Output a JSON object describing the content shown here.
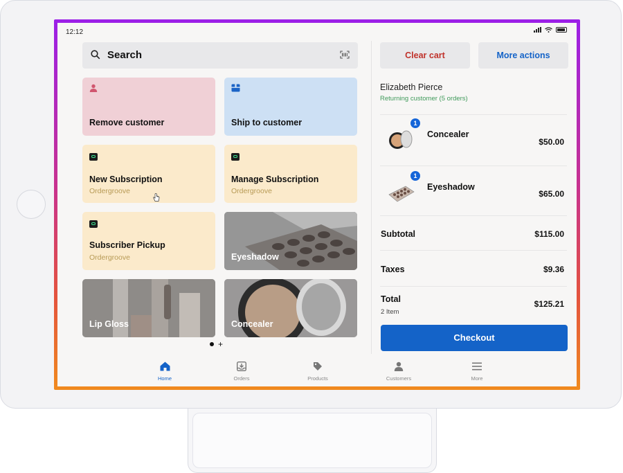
{
  "status_bar": {
    "time": "12:12"
  },
  "search": {
    "label": "Search",
    "icon": "search-icon",
    "scan_icon": "barcode-scan-icon"
  },
  "tiles": {
    "remove_customer": {
      "title": "Remove customer",
      "icon": "person-icon",
      "color": "#f0d0d6"
    },
    "ship_to_customer": {
      "title": "Ship to customer",
      "icon": "ship-box-icon",
      "color": "#cde0f4"
    },
    "new_subscription": {
      "title": "New Subscription",
      "subtitle": "Ordergroove",
      "color": "#fbeacb"
    },
    "manage_subscription": {
      "title": "Manage Subscription",
      "subtitle": "Ordergroove",
      "color": "#fbeacb"
    },
    "subscriber_pickup": {
      "title": "Subscriber Pickup",
      "subtitle": "Ordergroove",
      "color": "#fbeacb"
    },
    "eyeshadow": {
      "title": "Eyeshadow"
    },
    "lip_gloss": {
      "title": "Lip Gloss"
    },
    "concealer": {
      "title": "Concealer"
    }
  },
  "pager": {
    "add": "+"
  },
  "actions": {
    "clear_cart": "Clear cart",
    "more_actions": "More actions"
  },
  "customer": {
    "name": "Elizabeth Pierce",
    "status": "Returning customer (5 orders)"
  },
  "cart": {
    "items": [
      {
        "name": "Concealer",
        "qty": "1",
        "price": "$50.00"
      },
      {
        "name": "Eyeshadow",
        "qty": "1",
        "price": "$65.00"
      }
    ],
    "subtotal_label": "Subtotal",
    "subtotal": "$115.00",
    "taxes_label": "Taxes",
    "taxes": "$9.36",
    "total_label": "Total",
    "total": "$125.21",
    "item_count": "2 Item",
    "checkout": "Checkout"
  },
  "nav": [
    {
      "label": "Home",
      "icon": "home-icon",
      "active": true
    },
    {
      "label": "Orders",
      "icon": "orders-inbox-icon"
    },
    {
      "label": "Products",
      "icon": "tag-icon"
    },
    {
      "label": "Customers",
      "icon": "person-icon"
    },
    {
      "label": "More",
      "icon": "menu-icon"
    }
  ],
  "colors": {
    "accent": "#1463c8",
    "clear_cart": "#c0322b",
    "returning": "#3f9a5a",
    "frame_top": "#9b1fe8",
    "frame_bottom": "#f08a1e"
  }
}
